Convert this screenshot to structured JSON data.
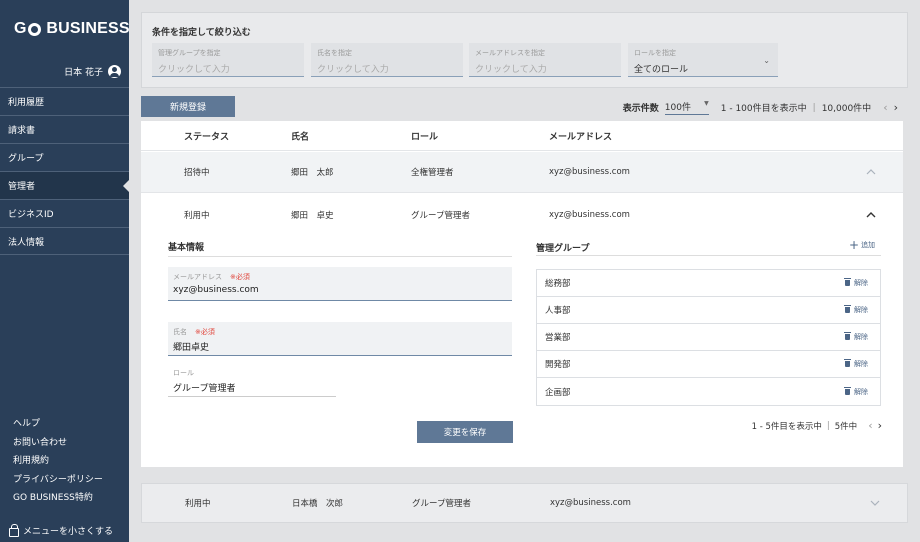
{
  "sidebar": {
    "logo_left": "G",
    "logo_right": "BUSINESS",
    "user_name": "日本 花子",
    "nav": [
      {
        "label": "利用履歴"
      },
      {
        "label": "請求書"
      },
      {
        "label": "グループ"
      },
      {
        "label": "管理者"
      },
      {
        "label": "ビジネスID"
      },
      {
        "label": "法人情報"
      }
    ],
    "footer": [
      "ヘルプ",
      "お問い合わせ",
      "利用規約",
      "プライバシーポリシー",
      "GO BUSINESS特約"
    ],
    "collapse_label": "メニューを小さくする"
  },
  "filter": {
    "title": "条件を指定して絞り込む",
    "group": {
      "label": "管理グループを指定",
      "placeholder": "クリックして入力"
    },
    "name": {
      "label": "氏名を指定",
      "placeholder": "クリックして入力"
    },
    "email": {
      "label": "メールアドレスを指定",
      "placeholder": "クリックして入力"
    },
    "role": {
      "label": "ロールを指定",
      "value": "全てのロール"
    }
  },
  "new_button": "新規登録",
  "pager_top": {
    "label": "表示件数",
    "per_page": "100件",
    "range": "1 - 100件目を表示中",
    "total": "10,000件中"
  },
  "table": {
    "headers": {
      "status": "ステータス",
      "name": "氏名",
      "role": "ロール",
      "email": "メールアドレス"
    },
    "rows": [
      {
        "status": "招待中",
        "name": "郷田　太郎",
        "role": "全権管理者",
        "email": "xyz@business.com"
      },
      {
        "status": "利用中",
        "name": "郷田　卓史",
        "role": "グループ管理者",
        "email": "xyz@business.com"
      },
      {
        "status": "利用中",
        "name": "日本橋　次郎",
        "role": "グループ管理者",
        "email": "xyz@business.com"
      }
    ]
  },
  "detail": {
    "basic_title": "基本情報",
    "email_label": "メールアドレス",
    "email_required": "※必須",
    "email_value": "xyz@business.com",
    "name_label": "氏名",
    "name_required": "※必須",
    "name_value": "郷田卓史",
    "role_label": "ロール",
    "role_value": "グループ管理者",
    "save_label": "変更を保存",
    "groups_title": "管理グループ",
    "add_label": "追加",
    "remove_label": "解除",
    "groups": [
      "総務部",
      "人事部",
      "営業部",
      "開発部",
      "企画部"
    ],
    "pager_range": "1 - 5件目を表示中",
    "pager_total": "5件中"
  }
}
